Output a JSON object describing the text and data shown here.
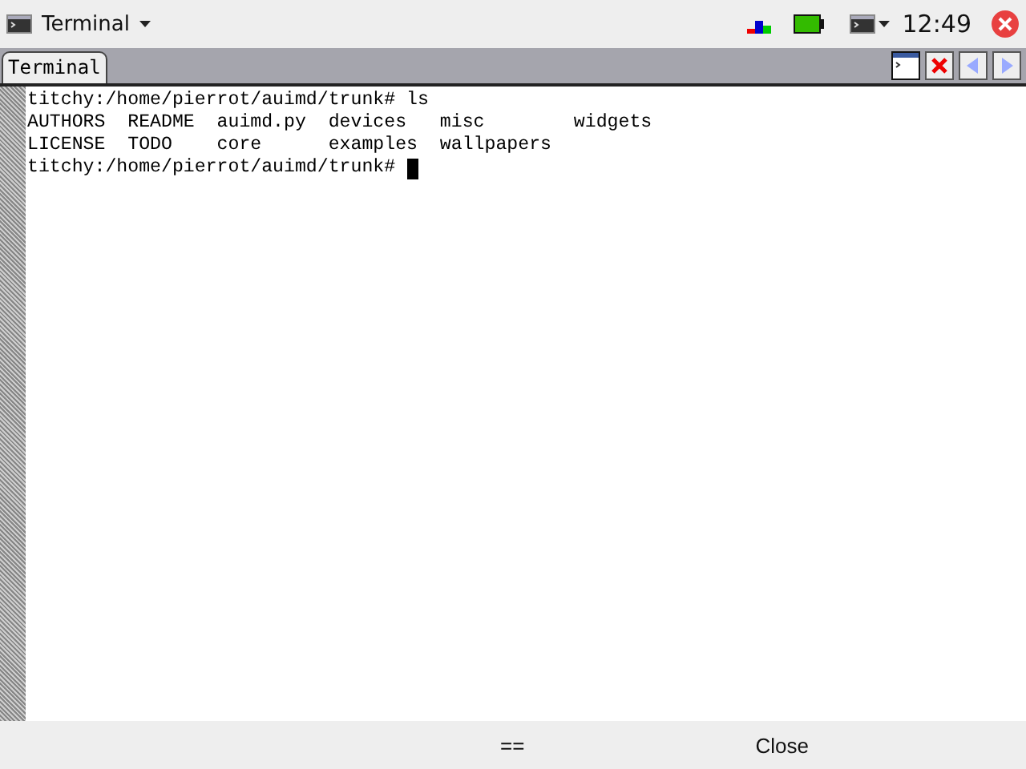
{
  "top_bar": {
    "app_title": "Terminal",
    "clock": "12:49"
  },
  "tabs": [
    {
      "label": "Terminal",
      "selected": true
    }
  ],
  "terminal": {
    "lines": [
      "titchy:/home/pierrot/auimd/trunk# ls",
      "AUTHORS  README  auimd.py  devices   misc        widgets",
      "LICENSE  TODO    core      examples  wallpapers",
      "titchy:/home/pierrot/auimd/trunk# "
    ]
  },
  "bottom_bar": {
    "buttons": [
      "==",
      "Close"
    ]
  }
}
